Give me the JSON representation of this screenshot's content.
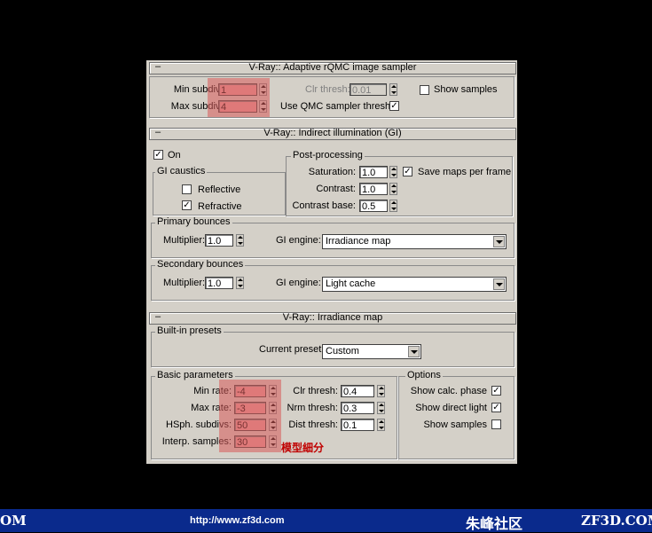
{
  "sampler": {
    "title": "V-Ray:: Adaptive rQMC image sampler",
    "min_subdivs_label": "Min subdivs:",
    "min_subdivs_value": "1",
    "max_subdivs_label": "Max subdivs:",
    "max_subdivs_value": "4",
    "clr_thresh_label": "Clr thresh:",
    "clr_thresh_value": "0.01",
    "show_samples_label": "Show samples",
    "show_samples_checked": false,
    "use_qmc_label": "Use QMC sampler thresh.",
    "use_qmc_checked": true
  },
  "gi": {
    "title": "V-Ray:: Indirect illumination (GI)",
    "on_label": "On",
    "on_checked": true,
    "caustics": {
      "legend": "GI caustics",
      "reflective_label": "Reflective",
      "reflective_checked": false,
      "refractive_label": "Refractive",
      "refractive_checked": true
    },
    "post": {
      "legend": "Post-processing",
      "saturation_label": "Saturation:",
      "saturation_value": "1.0",
      "save_maps_label": "Save maps per frame",
      "save_maps_checked": true,
      "contrast_label": "Contrast:",
      "contrast_value": "1.0",
      "contrast_base_label": "Contrast base:",
      "contrast_base_value": "0.5"
    },
    "primary": {
      "legend": "Primary bounces",
      "multiplier_label": "Multiplier:",
      "multiplier_value": "1.0",
      "engine_label": "GI engine:",
      "engine_value": "Irradiance map"
    },
    "secondary": {
      "legend": "Secondary bounces",
      "multiplier_label": "Multiplier:",
      "multiplier_value": "1.0",
      "engine_label": "GI engine:",
      "engine_value": "Light cache"
    }
  },
  "irradiance": {
    "title": "V-Ray:: Irradiance map",
    "presets": {
      "legend": "Built-in presets",
      "current_label": "Current preset:",
      "current_value": "Custom"
    },
    "basic": {
      "legend": "Basic parameters",
      "min_rate_label": "Min rate:",
      "min_rate_value": "-4",
      "max_rate_label": "Max rate:",
      "max_rate_value": "-3",
      "hsph_label": "HSph. subdivs:",
      "hsph_value": "50",
      "interp_label": "Interp. samples:",
      "interp_value": "30",
      "clr_thresh_label": "Clr thresh:",
      "clr_thresh_value": "0.4",
      "nrm_thresh_label": "Nrm thresh:",
      "nrm_thresh_value": "0.3",
      "dist_thresh_label": "Dist thresh:",
      "dist_thresh_value": "0.1"
    },
    "options": {
      "legend": "Options",
      "show_calc_label": "Show calc. phase",
      "show_calc_checked": true,
      "show_direct_label": "Show direct light",
      "show_direct_checked": true,
      "show_samples_label": "Show samples",
      "show_samples_checked": false
    }
  },
  "annotation": "模型細分",
  "footer": {
    "left": "OM",
    "url": "http://www.zf3d.com",
    "brand": "朱峰社区",
    "domain": "ZF3D.COM"
  },
  "colors": {
    "panel_bg": "#d4d0c8",
    "highlight": "#d75a5a",
    "annotation": "#c00000",
    "footer_bg": "#0a2a8c"
  }
}
